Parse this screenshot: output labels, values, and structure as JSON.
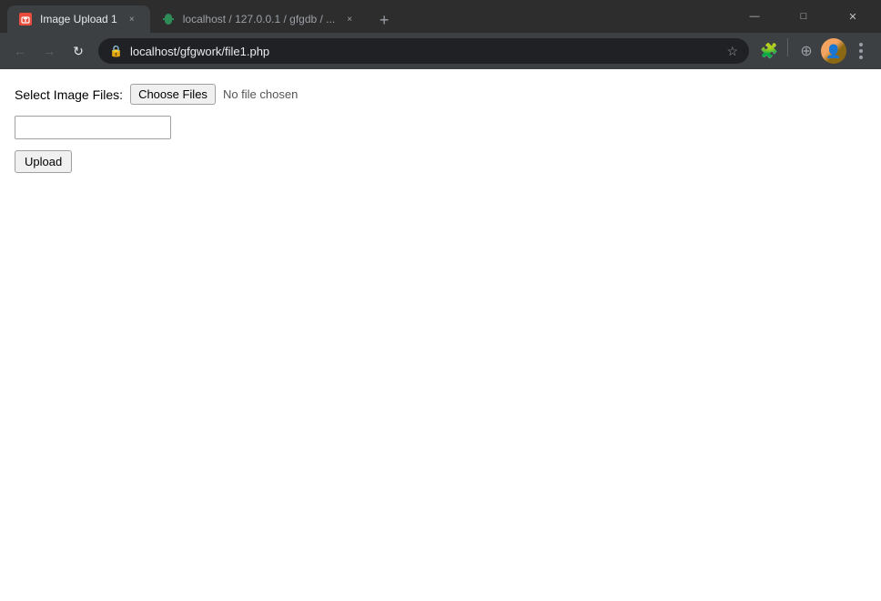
{
  "browser": {
    "tabs": [
      {
        "id": "tab1",
        "favicon_type": "img",
        "title": "Image Upload 1",
        "active": true,
        "close_icon": "×"
      },
      {
        "id": "tab2",
        "favicon_type": "gfg",
        "title": "localhost / 127.0.0.1 / gfgdb / ...",
        "active": false,
        "close_icon": "×"
      }
    ],
    "new_tab_icon": "+",
    "window_controls": {
      "minimize": "—",
      "maximize": "□",
      "close": "✕"
    },
    "nav": {
      "back": "←",
      "forward": "→",
      "refresh": "↻",
      "url": "localhost/gfgwork/file1.php",
      "lock_icon": "🔒",
      "star_icon": "☆",
      "extensions_icon": "🧩",
      "shield_icon": "⊕",
      "menu_label": "⋮"
    }
  },
  "page": {
    "label": "Select Image Files:",
    "choose_files_label": "Choose Files",
    "no_file_text": "No file chosen",
    "text_input_placeholder": "",
    "upload_label": "Upload"
  }
}
